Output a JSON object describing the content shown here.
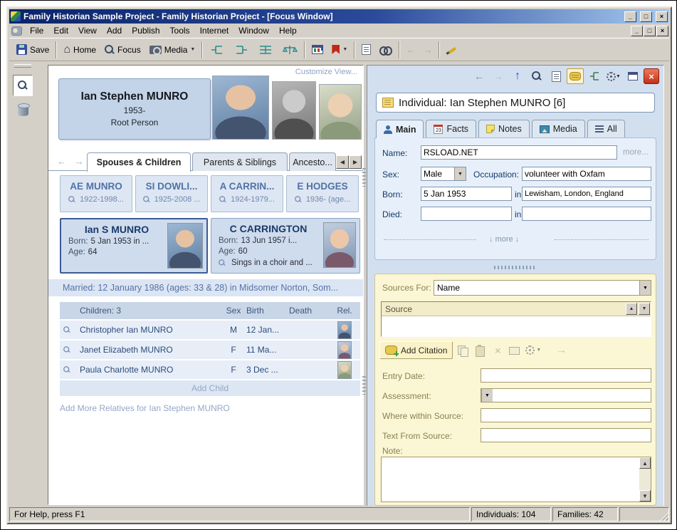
{
  "window": {
    "title": "Family Historian Sample Project - Family Historian Project - [Focus Window]"
  },
  "menu": {
    "items": [
      "File",
      "Edit",
      "View",
      "Add",
      "Publish",
      "Tools",
      "Internet",
      "Window",
      "Help"
    ]
  },
  "toolbar": {
    "save": "Save",
    "home": "Home",
    "focus": "Focus",
    "media": "Media"
  },
  "focus_window": {
    "customize_link": "Customize View...",
    "root_person": {
      "name": "Ian Stephen MUNRO",
      "dates": "1953-",
      "caption": "Root Person"
    },
    "tabs": [
      "Spouses & Children",
      "Parents & Siblings",
      "Ancesto..."
    ],
    "parents": [
      {
        "name": "AE MUNRO",
        "dates": "1922-1998..."
      },
      {
        "name": "SI DOWLI...",
        "dates": "1925-2008 ..."
      },
      {
        "name": "A CARRIN...",
        "dates": "1924-1979..."
      },
      {
        "name": "E HODGES",
        "dates": "1936- (age..."
      }
    ],
    "couple": {
      "person": {
        "name": "Ian S MUNRO",
        "born_label": "Born:",
        "born": "5 Jan 1953 in ...",
        "age_label": "Age:",
        "age": "64"
      },
      "spouse": {
        "name": "C CARRINGTON",
        "born_label": "Born:",
        "born": "13 Jun 1957 i...",
        "age_label": "Age:",
        "age": "60",
        "note": "Sings in a choir and ..."
      }
    },
    "marriage": "Married: 12 January 1986 (ages: 33 & 28) in Midsomer Norton, Som...",
    "children": {
      "header": {
        "name": "Children: 3",
        "sex": "Sex",
        "birth": "Birth",
        "death": "Death",
        "rel": "Rel."
      },
      "rows": [
        {
          "name": "Christopher Ian MUNRO",
          "sex": "M",
          "birth": "12 Jan...",
          "death": ""
        },
        {
          "name": "Janet Elizabeth MUNRO",
          "sex": "F",
          "birth": "11 Ma...",
          "death": ""
        },
        {
          "name": "Paula Charlotte MUNRO",
          "sex": "F",
          "birth": "3 Dec ...",
          "death": ""
        }
      ],
      "add_child": "Add Child"
    },
    "add_more": "Add More Relatives for Ian Stephen MUNRO"
  },
  "property_box": {
    "title": "Individual: Ian Stephen MUNRO [6]",
    "tabs": [
      "Main",
      "Facts",
      "Notes",
      "Media",
      "All"
    ],
    "facts_badge": "23",
    "main_tab": {
      "name_label": "Name:",
      "name_value": "RSLOAD.NET",
      "more_link": "more...",
      "sex_label": "Sex:",
      "sex_value": "Male",
      "occupation_label": "Occupation:",
      "occupation_value": "volunteer with Oxfam",
      "born_label": "Born:",
      "born_value": "5 Jan 1953",
      "in_label": "in",
      "born_place": "Lewisham, London, England",
      "died_label": "Died:",
      "died_value": "",
      "died_place": "",
      "more_divider": "more"
    },
    "sources": {
      "for_label": "Sources For:",
      "for_value": "Name",
      "list_header": "Source",
      "add_citation": "Add Citation",
      "entry_date_label": "Entry Date:",
      "entry_date_value": "",
      "assessment_label": "Assessment:",
      "assessment_value": "",
      "where_label": "Where within Source:",
      "where_value": "",
      "text_label": "Text From Source:",
      "text_value": "",
      "note_label": "Note:",
      "note_value": ""
    }
  },
  "statusbar": {
    "help": "For Help, press F1",
    "individuals": "Individuals: 104",
    "families": "Families: 42"
  },
  "icons": {
    "minimize": "_",
    "maximize": "□",
    "close": "×",
    "back": "←",
    "forward": "→",
    "up": "↑",
    "down": "↓",
    "left_small": "◀",
    "right_small": "▶",
    "dropdown": "▼",
    "sort_up": "▲",
    "sort_down": "▼",
    "house": "⌂",
    "tab_arrows": "← →",
    "more_down": "↓"
  },
  "colors": {
    "titlebar": "#0a246a",
    "chrome": "#d4d0c8",
    "panel_blue": "#e7f0fa",
    "panel_yellow": "#fbf6d4",
    "accent_link": "#93a7c7",
    "name_blue": "#5271a7"
  }
}
